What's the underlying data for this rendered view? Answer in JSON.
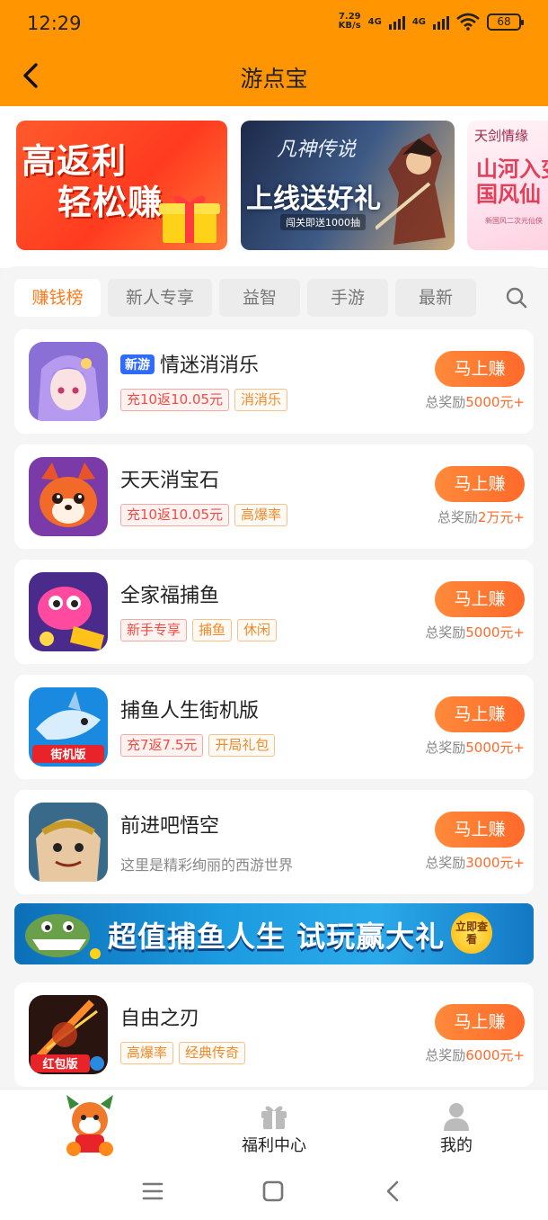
{
  "status_bar": {
    "time": "12:29",
    "speed_value": "7.29",
    "speed_unit": "KB/s",
    "net1": "4G",
    "net2": "4G",
    "battery": "68"
  },
  "header": {
    "title": "游点宝"
  },
  "banners": [
    {
      "line1": "高返利",
      "line2": "轻松赚"
    },
    {
      "logo": "凡神传说",
      "headline": "上线送好礼",
      "subtitle": "闯关即送1000抽"
    },
    {
      "top": "天剑情缘",
      "line1": "山河入变",
      "line2": "国风仙",
      "footer": "新国风二次元仙侠"
    }
  ],
  "tabs": [
    {
      "label": "赚钱榜",
      "active": true
    },
    {
      "label": "新人专享",
      "active": false
    },
    {
      "label": "益智",
      "active": false
    },
    {
      "label": "手游",
      "active": false
    },
    {
      "label": "最新",
      "active": false
    }
  ],
  "games": [
    {
      "badge": "新游",
      "name": "情迷消消乐",
      "tags": [
        {
          "text": "充10返10.05元",
          "style": "red"
        },
        {
          "text": "消消乐",
          "style": "orange"
        }
      ],
      "cta": "马上赚",
      "reward_prefix": "总奖励",
      "reward_amount": "5000元+"
    },
    {
      "name": "天天消宝石",
      "tags": [
        {
          "text": "充10返10.05元",
          "style": "red"
        },
        {
          "text": "高爆率",
          "style": "orange"
        }
      ],
      "cta": "马上赚",
      "reward_prefix": "总奖励",
      "reward_amount": "2万元+"
    },
    {
      "name": "全家福捕鱼",
      "tags": [
        {
          "text": "新手专享",
          "style": "red"
        },
        {
          "text": "捕鱼",
          "style": "orange"
        },
        {
          "text": "休闲",
          "style": "orange"
        }
      ],
      "cta": "马上赚",
      "reward_prefix": "总奖励",
      "reward_amount": "5000元+"
    },
    {
      "name": "捕鱼人生街机版",
      "icon_label": "街机版",
      "tags": [
        {
          "text": "充7返7.5元",
          "style": "red"
        },
        {
          "text": "开局礼包",
          "style": "orange"
        }
      ],
      "cta": "马上赚",
      "reward_prefix": "总奖励",
      "reward_amount": "5000元+"
    },
    {
      "name": "前进吧悟空",
      "desc": "这里是精彩绚丽的西游世界",
      "cta": "马上赚",
      "reward_prefix": "总奖励",
      "reward_amount": "3000元+"
    },
    {
      "name": "自由之刃",
      "icon_label": "红包版",
      "tags": [
        {
          "text": "高爆率",
          "style": "orange"
        },
        {
          "text": "经典传奇",
          "style": "orange"
        }
      ],
      "cta": "马上赚",
      "reward_prefix": "总奖励",
      "reward_amount": "6000元+"
    }
  ],
  "ad_banner": {
    "text": "超值捕鱼人生 试玩赢大礼",
    "button": "立即查看"
  },
  "bottom_nav": [
    {
      "label": ""
    },
    {
      "label": "福利中心"
    },
    {
      "label": "我的"
    }
  ],
  "colors": {
    "brand_orange": "#ff9500",
    "cta_orange": "#ff6a2a",
    "badge_blue": "#2f6bff"
  }
}
